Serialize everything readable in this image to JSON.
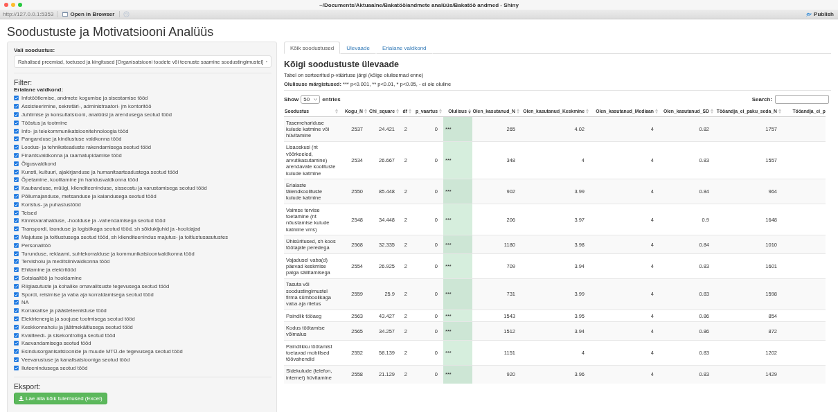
{
  "window": {
    "title": "~/Documents/Aktuaalne/Bakatöö/andmete analüüs/Bakatöö andmed - Shiny"
  },
  "toolbar": {
    "url": "http://127.0.0.1:5353",
    "open_button": "Open in Browser",
    "publish_button": "Publish"
  },
  "page_title": "Soodustuste ja Motivatsiooni Analüüs",
  "sidebar": {
    "select_label": "Vali soodustus:",
    "select_value": "Rahalised preemiad, toetused ja kingitused [Organisatsiooni toodete või teenuste saamine soodustingimustel]",
    "filter_heading": "Filter:",
    "group_label": "Erialane valdkond:",
    "filters": [
      {
        "label": "Infotöötlemise, andmete kogumise ja sisestamise tööd",
        "checked": true
      },
      {
        "label": "Assisteerimine, sekretäri-, administraatori- jm kontoritöö",
        "checked": true
      },
      {
        "label": "Juhtimise ja konsultatsiooni, analüüsi ja arendusega seotud tööd",
        "checked": true
      },
      {
        "label": "Tööstus ja tootmine",
        "checked": true
      },
      {
        "label": "Info- ja telekommunikatsioonitehnoloogia tööd",
        "checked": true
      },
      {
        "label": "Panganduse ja kindlustuse valdkonna tööd",
        "checked": true
      },
      {
        "label": "Loodus- ja tehnikateaduste rakendamisega seotud tööd",
        "checked": true
      },
      {
        "label": "Finantsvaldkonna ja raamatupidamise tööd",
        "checked": true
      },
      {
        "label": "Õigusvaldkond",
        "checked": true
      },
      {
        "label": "Kunsti, kultuuri, ajakirjanduse ja humanitaarteadustega seotud tööd",
        "checked": true
      },
      {
        "label": "Õpetamine, koolitamine jm haridusvaldkonna tööd",
        "checked": true
      },
      {
        "label": "Kaubanduse, müügi, klienditeeninduse, sisseostu ja varustamisega seotud tööd",
        "checked": true
      },
      {
        "label": "Põllumajanduse, metsanduse ja kalandusega seotud tööd",
        "checked": true
      },
      {
        "label": "Koristus- ja puhastustööd",
        "checked": true
      },
      {
        "label": "Teised",
        "checked": true
      },
      {
        "label": "Kinnisvarahalduse, -hoolduse ja -vahendamisega seotud tööd",
        "checked": true
      },
      {
        "label": "Transpordi, laonduse ja logistikaga seotud tööd, sh sõidukijuhid ja -hooldajad",
        "checked": true
      },
      {
        "label": "Majutuse ja toitlustusega seotud tööd, sh klienditeenindus majutus- ja toitlustusasutustes",
        "checked": true
      },
      {
        "label": "Personalitöö",
        "checked": true
      },
      {
        "label": "Turunduse, reklaami, suhtekorralduse ja kommunikatsioonivaldkonna tööd",
        "checked": true
      },
      {
        "label": "Tervishoiu ja meditsiinivaldkonna tööd",
        "checked": true
      },
      {
        "label": "Ehitamine ja elektritööd",
        "checked": true
      },
      {
        "label": "Sotsiaaltöö ja hooldamine",
        "checked": true
      },
      {
        "label": "Riigiasutuste ja kohalike omavalitsuste tegevusega seotud tööd",
        "checked": true
      },
      {
        "label": "Spordi, reisimise ja vaba aja korraldamisega seotud tööd",
        "checked": true
      },
      {
        "label": "NA",
        "checked": true
      },
      {
        "label": "Korrakaitse ja päästeteenistuse tööd",
        "checked": true
      },
      {
        "label": "Elektrienergia ja soojuse tootmisega seotud tööd",
        "checked": true
      },
      {
        "label": "Keskkonnahoiu ja jäätmekäitlusega seotud tööd",
        "checked": true
      },
      {
        "label": "Kvaliteedi- ja sisekontrolliga seotud tööd",
        "checked": true
      },
      {
        "label": "Kaevandamisega seotud tööd",
        "checked": true
      },
      {
        "label": "Esindusorganisatsioonide ja muude MTÜ-de tegevusega seotud tööd",
        "checked": true
      },
      {
        "label": "Veevarustuse ja kanalisatsiooniga seotud tööd",
        "checked": true
      },
      {
        "label": "Iluteenindusega seotud tööd",
        "checked": true
      }
    ],
    "export_heading": "Eksport:",
    "export_button": "Lae alla kõik tulemused (Excel)"
  },
  "tabs": [
    {
      "label": "Kõik soodustused",
      "selected": true
    },
    {
      "label": "Ülevaade",
      "selected": false
    },
    {
      "label": "Erialane valdkond",
      "selected": false
    }
  ],
  "heading": "Kõigi soodustuste ülevaade",
  "note": "Tabel on sorteeritud p-väärtuse järgi (kõige olulisemad enne)",
  "legend": {
    "label": "Olulisuse märgistused:",
    "text": "*** p<0.001, ** p<0.01, * p<0.05, - ei ole oluline"
  },
  "table": {
    "show_label": "Show",
    "page_length": "50",
    "entries_label": "entries",
    "search_label": "Search:",
    "columns": [
      {
        "label": "Soodustus",
        "sorted": false
      },
      {
        "label": "Kogu_N",
        "sorted": false
      },
      {
        "label": "Chi_square",
        "sorted": false
      },
      {
        "label": "df",
        "sorted": false
      },
      {
        "label": "p_vaartus",
        "sorted": false
      },
      {
        "label": "Olulisus",
        "sorted": true
      },
      {
        "label": "Olen_kasutanud_N",
        "sorted": false
      },
      {
        "label": "Olen_kasutanud_Keskmine",
        "sorted": false
      },
      {
        "label": "Olen_kasutanud_Mediaan",
        "sorted": false
      },
      {
        "label": "Olen_kasutanud_SD",
        "sorted": false
      },
      {
        "label": "Tööandja_ei_paku_seda_N",
        "sorted": false
      },
      {
        "label": "Tööandja_ei_p",
        "sorted": false
      }
    ],
    "rows": [
      {
        "cells": [
          "Tasemehariduse kulude katmine või hüvitamine",
          "2537",
          "24.421",
          "2",
          "0",
          "***",
          "265",
          "4.02",
          "4",
          "0.82",
          "1757"
        ]
      },
      {
        "cells": [
          "Lisaoskusi (nt võõrkeeled, arvutikasutamine) arendavate koolituste kulude katmine",
          "2534",
          "26.667",
          "2",
          "0",
          "***",
          "348",
          "4",
          "4",
          "0.83",
          "1557"
        ]
      },
      {
        "cells": [
          "Erialaste täiendkoolituste kulude katmine",
          "2550",
          "85.448",
          "2",
          "0",
          "***",
          "902",
          "3.99",
          "4",
          "0.84",
          "964"
        ]
      },
      {
        "cells": [
          "Vaimse tervise toetamine (nt nõustamise kulude katmine vms)",
          "2548",
          "34.448",
          "2",
          "0",
          "***",
          "206",
          "3.97",
          "4",
          "0.9",
          "1648"
        ]
      },
      {
        "cells": [
          "Ühisüritused, sh koos töötajate peredega",
          "2568",
          "32.335",
          "2",
          "0",
          "***",
          "1180",
          "3.98",
          "4",
          "0.84",
          "1010"
        ]
      },
      {
        "cells": [
          "Vajadusel vaba(d) päevad keskmise palga säilitamisega",
          "2554",
          "26.925",
          "2",
          "0",
          "***",
          "709",
          "3.94",
          "4",
          "0.83",
          "1601"
        ]
      },
      {
        "cells": [
          "Tasuta või soodustingimustel firma sümboolikaga vaba aja riietus",
          "2559",
          "25.9",
          "2",
          "0",
          "***",
          "731",
          "3.99",
          "4",
          "0.83",
          "1598"
        ]
      },
      {
        "cells": [
          "Paindlik tööaeg",
          "2563",
          "43.427",
          "2",
          "0",
          "***",
          "1543",
          "3.95",
          "4",
          "0.86",
          "854"
        ]
      },
      {
        "cells": [
          "Kodus töötamise võimalus",
          "2565",
          "34.257",
          "2",
          "0",
          "***",
          "1512",
          "3.94",
          "4",
          "0.86",
          "872"
        ]
      },
      {
        "cells": [
          "Paindlikku töötamist toetavad mobiilsed töövahendid",
          "2552",
          "58.139",
          "2",
          "0",
          "***",
          "1151",
          "4",
          "4",
          "0.83",
          "1202"
        ]
      },
      {
        "cells": [
          "Sidekulude (telefon, internet) hüvitamine",
          "2558",
          "21.129",
          "2",
          "0",
          "***",
          "920",
          "3.96",
          "4",
          "0.83",
          "1429"
        ]
      }
    ]
  }
}
